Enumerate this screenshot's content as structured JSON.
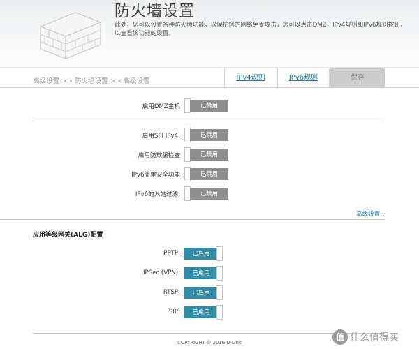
{
  "header": {
    "title": "防火墙设置",
    "description": "此处，您可以设置各种防火墙功能，以保护您的网络免受攻击。您可以点击DMZ，IPv4规则和IPv6规则按钮，以查看该功能的设置。"
  },
  "nav": {
    "breadcrumb": "高级设置 >> 防火墙设置 >> 高级设置",
    "tab_ipv4": "IPv4规则",
    "tab_ipv6": "IPv6规则",
    "save": "保存"
  },
  "dmz": {
    "label": "启用DMZ主机",
    "state": "已禁用"
  },
  "firewall_options": [
    {
      "label": "启用SPI IPv4:",
      "state": "已禁用"
    },
    {
      "label": "启用防欺骗检查",
      "state": "已禁用"
    },
    {
      "label": "IPv6简单安全功能",
      "state": "已禁用"
    },
    {
      "label": "IPv6的入站过滤:",
      "state": "已禁用"
    }
  ],
  "advanced_link": "高级设置...",
  "alg": {
    "title": "应用等级网关(ALG)配置",
    "items": [
      {
        "label": "PPTP:",
        "state": "已启用"
      },
      {
        "label": "IPSec (VPN):",
        "state": "已启用"
      },
      {
        "label": "RTSP:",
        "state": "已启用"
      },
      {
        "label": "SIP:",
        "state": "已启用"
      }
    ]
  },
  "footer": {
    "copyright": "COPYRIGHT © 2016 D-Link"
  },
  "watermark": {
    "logo_char": "值",
    "text": "什么值得买"
  },
  "colors": {
    "enabled": "#2f8da8",
    "disabled": "#8e8e8e",
    "link": "#1f7ba0",
    "save_bg": "#cccccc"
  }
}
